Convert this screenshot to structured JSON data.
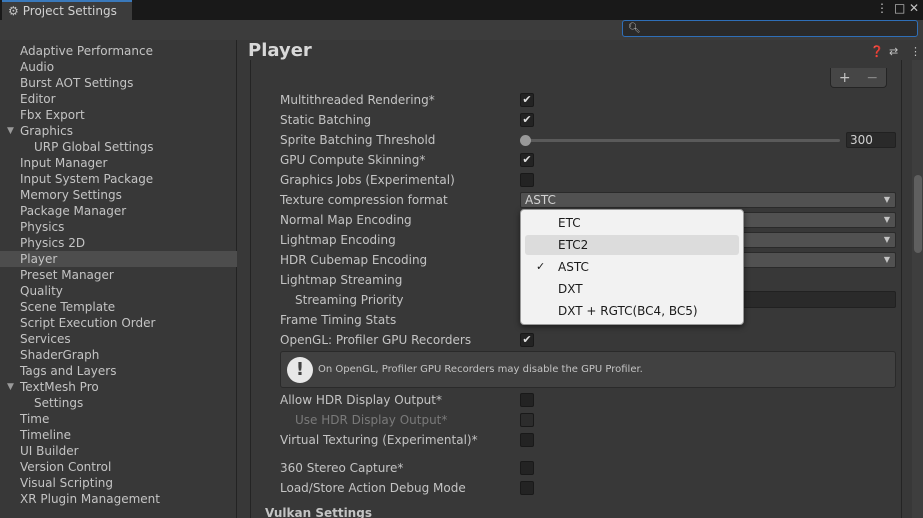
{
  "window": {
    "tab_title": "Project Settings",
    "controls": [
      "⋮",
      "□",
      "✕"
    ]
  },
  "search": {
    "placeholder": "",
    "value": ""
  },
  "sidebar": {
    "items": [
      {
        "label": "Adaptive Performance"
      },
      {
        "label": "Audio"
      },
      {
        "label": "Burst AOT Settings"
      },
      {
        "label": "Editor"
      },
      {
        "label": "Fbx Export"
      },
      {
        "label": "Graphics",
        "expanded": true
      },
      {
        "label": "URP Global Settings",
        "child": true
      },
      {
        "label": "Input Manager"
      },
      {
        "label": "Input System Package"
      },
      {
        "label": "Memory Settings"
      },
      {
        "label": "Package Manager"
      },
      {
        "label": "Physics"
      },
      {
        "label": "Physics 2D"
      },
      {
        "label": "Player",
        "selected": true
      },
      {
        "label": "Preset Manager"
      },
      {
        "label": "Quality"
      },
      {
        "label": "Scene Template"
      },
      {
        "label": "Script Execution Order"
      },
      {
        "label": "Services"
      },
      {
        "label": "ShaderGraph"
      },
      {
        "label": "Tags and Layers"
      },
      {
        "label": "TextMesh Pro",
        "expanded": true
      },
      {
        "label": "Settings",
        "child": true
      },
      {
        "label": "Time"
      },
      {
        "label": "Timeline"
      },
      {
        "label": "UI Builder"
      },
      {
        "label": "Version Control"
      },
      {
        "label": "Visual Scripting"
      },
      {
        "label": "XR Plugin Management"
      }
    ]
  },
  "main": {
    "title": "Player",
    "rows": {
      "multithreaded_rendering": {
        "label": "Multithreaded Rendering*",
        "checked": true
      },
      "static_batching": {
        "label": "Static Batching",
        "checked": true
      },
      "sprite_batching_threshold": {
        "label": "Sprite Batching Threshold",
        "value": "300",
        "level": 0
      },
      "gpu_compute_skinning": {
        "label": "GPU Compute Skinning*",
        "checked": true
      },
      "graphics_jobs": {
        "label": "Graphics Jobs (Experimental)",
        "checked": false
      },
      "texture_compression_format": {
        "label": "Texture compression format",
        "value": "ASTC"
      },
      "normal_map_encoding": {
        "label": "Normal Map Encoding"
      },
      "lightmap_encoding": {
        "label": "Lightmap Encoding"
      },
      "hdr_cubemap_encoding": {
        "label": "HDR Cubemap Encoding"
      },
      "lightmap_streaming": {
        "label": "Lightmap Streaming"
      },
      "streaming_priority": {
        "label": "Streaming Priority"
      },
      "frame_timing_stats": {
        "label": "Frame Timing Stats"
      },
      "opengl_profiler": {
        "label": "OpenGL: Profiler GPU Recorders",
        "checked": true
      },
      "allow_hdr_display": {
        "label": "Allow HDR Display Output*",
        "checked": false
      },
      "use_hdr_display": {
        "label": "Use HDR Display Output*",
        "checked": false
      },
      "virtual_texturing": {
        "label": "Virtual Texturing (Experimental)*",
        "checked": false
      },
      "stereo_capture": {
        "label": "360 Stereo Capture*",
        "checked": false
      },
      "load_store_debug": {
        "label": "Load/Store Action Debug Mode",
        "checked": false
      }
    },
    "help_message": "On OpenGL, Profiler GPU Recorders may disable the GPU Profiler.",
    "next_section": "Vulkan Settings"
  },
  "popup": {
    "options": [
      {
        "label": "ETC",
        "checked": false
      },
      {
        "label": "ETC2",
        "checked": false,
        "hover": true
      },
      {
        "label": "ASTC",
        "checked": true
      },
      {
        "label": "DXT",
        "checked": false
      },
      {
        "label": "DXT + RGTC(BC4, BC5)",
        "checked": false
      }
    ]
  },
  "colors": {
    "accent": "#3a79bb",
    "background": "#383838",
    "selected": "#4d4d4d",
    "popup_bg": "#f2f2f2"
  }
}
